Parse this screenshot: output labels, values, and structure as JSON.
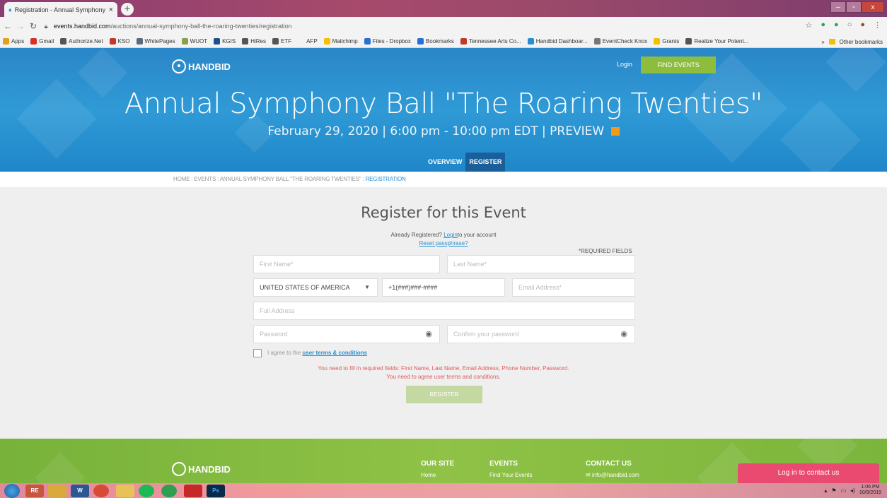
{
  "browser": {
    "tab_title": "Registration - Annual Symphony",
    "tab_close": "×",
    "new_tab": "+",
    "window_buttons": [
      "–",
      "▫",
      "x"
    ],
    "url_domain": "events.handbid.com",
    "url_path": "/auctions/annual-symphony-ball-the-roaring-twenties/registration",
    "bookmarks": [
      {
        "label": "Apps",
        "color": "#e3a21a"
      },
      {
        "label": "Gmail",
        "color": "#d93025"
      },
      {
        "label": "Authorize.Net",
        "color": "#555555"
      },
      {
        "label": "KSO",
        "color": "#c0392b"
      },
      {
        "label": "WhitePages",
        "color": "#5b6b7b"
      },
      {
        "label": "WUOT",
        "color": "#8aa34a"
      },
      {
        "label": "KGIS",
        "color": "#1f4e8c"
      },
      {
        "label": "HiRes",
        "color": "#555555"
      },
      {
        "label": "ETF",
        "color": "#555555"
      },
      {
        "label": "AFP",
        "color": "#f3f3f3"
      },
      {
        "label": "Mailchimp",
        "color": "#f2c200"
      },
      {
        "label": "Files - Dropbox",
        "color": "#2b6fd6"
      },
      {
        "label": "Bookmarks",
        "color": "#2b6fd6"
      },
      {
        "label": "Tennessee Arts Co...",
        "color": "#c0392b"
      },
      {
        "label": "Handbid Dashboar...",
        "color": "#2a8fd0"
      },
      {
        "label": "EventCheck Knox",
        "color": "#777777"
      },
      {
        "label": "Grants",
        "color": "#f2c200"
      },
      {
        "label": "Realize Your Potent...",
        "color": "#555555"
      }
    ],
    "bookmarks_more": "»",
    "other_bookmarks": "Other bookmarks"
  },
  "header": {
    "logo_text": "HANDBID",
    "login": "Login",
    "find_events": "FIND EVENTS",
    "event_title": "Annual Symphony Ball \"The Roaring Twenties\"",
    "event_date": "February 29, 2020 | 6:00 pm - 10:00 pm EDT | PREVIEW",
    "tabs": [
      "OVERVIEW",
      "REGISTER"
    ]
  },
  "breadcrumb": {
    "path": "HOME : EVENTS : ANNUAL SYMPHONY BALL \"THE ROARING TWENTIES\" : ",
    "current": "REGISTRATION"
  },
  "form": {
    "title": "Register for this Event",
    "already_prefix": "Already Registered? ",
    "login_link": "Login",
    "already_suffix": "to your account",
    "reset_link": "Reset passphrase?",
    "required_note": "*REQUIRED FIELDS",
    "first_name_placeholder": "First Name*",
    "last_name_placeholder": "Last Name*",
    "country_value": "UNITED STATES OF AMERICA",
    "phone_value": "+1(###)###-####",
    "email_placeholder": "Email Address*",
    "address_placeholder": "Full Address",
    "password_placeholder": "Password",
    "confirm_placeholder": "Confirm your password",
    "agree_prefix": "I agree to the ",
    "agree_link": "user terms & conditions",
    "error_fields": "You need to fill in required fields: First Name, Last Name, Email Address, Phone Number, Password.",
    "error_terms": "You need to agree user terms and conditions.",
    "register_button": "REGISTER"
  },
  "footer": {
    "logo_text": "HANDBID",
    "col1_heading": "OUR SITE",
    "col1_item": "Home",
    "col2_heading": "EVENTS",
    "col2_item": "Find Your Events",
    "col3_heading": "CONTACT US",
    "col3_item": "info@handbid.com",
    "contact_button": "Log in to contact us"
  },
  "taskbar": {
    "apps": [
      "RE",
      "",
      "W",
      "",
      "",
      "",
      "",
      "",
      "Ps"
    ],
    "time": "1:06 PM",
    "date": "10/9/2019"
  },
  "colors": {
    "brand_blue": "#2a8fd0",
    "brand_green": "#8cbd3d",
    "error_red": "#e05a5a",
    "contact_pink": "#ea4a6f",
    "preview_orange": "#f39a1d"
  }
}
